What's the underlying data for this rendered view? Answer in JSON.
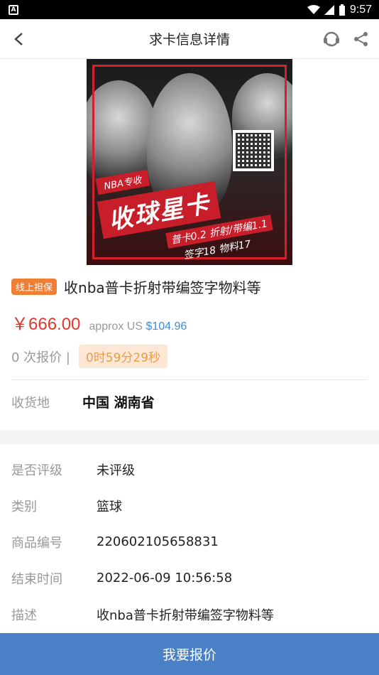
{
  "status_bar": {
    "time": "9:57"
  },
  "header": {
    "title": "求卡信息详情"
  },
  "hero": {
    "banner_small": "NBA专收",
    "banner_big": "收球星卡",
    "line3": "普卡0.2 折射/带编1.1",
    "line4": "签字18 物料17"
  },
  "item": {
    "badge": "线上担保",
    "title": "收nba普卡折射带编签字物料等",
    "price": "￥666.00",
    "approx_prefix": "approx US",
    "approx_usd": "$104.96",
    "bids": "0 次报价 |",
    "timer": "0时59分29秒"
  },
  "shipping": {
    "label": "收货地",
    "value": "中国 湖南省"
  },
  "details": [
    {
      "label": "是否评级",
      "value": "未评级"
    },
    {
      "label": "类别",
      "value": "篮球"
    },
    {
      "label": "商品编号",
      "value": "220602105658831"
    },
    {
      "label": "结束时间",
      "value": "2022-06-09 10:56:58"
    },
    {
      "label": "描述",
      "value": "收nba普卡折射带编签字物料等"
    }
  ],
  "action": {
    "label": "我要报价"
  },
  "icons": {
    "back": "back-arrow-icon",
    "service": "customer-service-icon",
    "share": "share-icon"
  },
  "colors": {
    "accent": "#e0372f",
    "button": "#4a80c6",
    "badge": "#f07f34",
    "timer_bg": "#fde8d6",
    "timer_text": "#f09a42",
    "usd": "#3b8cd8"
  }
}
